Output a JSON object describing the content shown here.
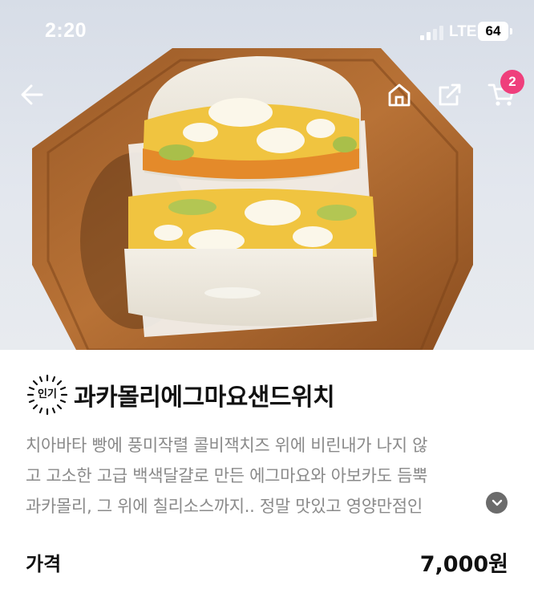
{
  "status_bar": {
    "time": "2:20",
    "network": "LTE",
    "battery": "64"
  },
  "header": {
    "cart_count": "2"
  },
  "product": {
    "badge": "인기",
    "title": "과카몰리에그마요샌드위치",
    "description_lines": [
      "치아바타 빵에 풍미작렬 콜비잭치즈 위에 비린내가 나지 않",
      "고 고소한 고급 백색달걀로 만든 에그마요와 아보카도 듬뿍",
      "과카몰리, 그 위에 칠리소스까지.. 정말 맛있고 영양만점인"
    ],
    "price_label": "가격",
    "price_value": "7,000원"
  },
  "colors": {
    "cart_badge": "#ef3f7c",
    "description_text": "#8a8a8a"
  }
}
